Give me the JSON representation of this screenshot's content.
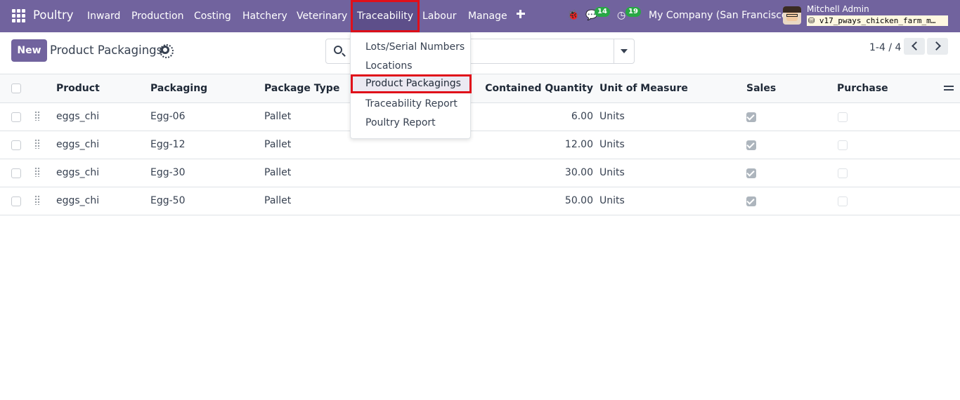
{
  "navbar": {
    "app_name": "Poultry",
    "menu": [
      {
        "label": "Inward",
        "active": false
      },
      {
        "label": "Production",
        "active": false
      },
      {
        "label": "Costing",
        "active": false
      },
      {
        "label": "Hatchery",
        "active": false
      },
      {
        "label": "Veterinary",
        "active": false
      },
      {
        "label": "Traceability",
        "active": true
      },
      {
        "label": "Labour",
        "active": false
      },
      {
        "label": "Manage",
        "active": false
      }
    ],
    "messages_count": "14",
    "activities_count": "19",
    "company": "My Company (San Francisco)",
    "user_name": "Mitchell Admin",
    "database": "v17_pways_chicken_farm_m…"
  },
  "control": {
    "new_label": "New",
    "title": "Product Packagings",
    "search_placeholder": "",
    "pager": "1-4 / 4"
  },
  "dropdown": {
    "items": [
      {
        "label": "Lots/Serial Numbers",
        "selected": false
      },
      {
        "label": "Locations",
        "selected": false
      },
      {
        "label": "Product Packagings",
        "selected": true
      },
      {
        "label": "Traceability Report",
        "selected": false
      },
      {
        "label": "Poultry Report",
        "selected": false
      }
    ]
  },
  "table": {
    "columns": [
      "Product",
      "Packaging",
      "Package Type",
      "Contained Quantity",
      "Unit of Measure",
      "Sales",
      "Purchase"
    ],
    "rows": [
      {
        "product": "eggs_chi",
        "packaging": "Egg-06",
        "package_type": "Pallet",
        "qty": "6.00",
        "uom": "Units",
        "sales": true,
        "purchase": false
      },
      {
        "product": "eggs_chi",
        "packaging": "Egg-12",
        "package_type": "Pallet",
        "qty": "12.00",
        "uom": "Units",
        "sales": true,
        "purchase": false
      },
      {
        "product": "eggs_chi",
        "packaging": "Egg-30",
        "package_type": "Pallet",
        "qty": "30.00",
        "uom": "Units",
        "sales": true,
        "purchase": false
      },
      {
        "product": "eggs_chi",
        "packaging": "Egg-50",
        "package_type": "Pallet",
        "qty": "50.00",
        "uom": "Units",
        "sales": true,
        "purchase": false
      }
    ]
  },
  "colors": {
    "navbar": "#71639e",
    "highlight_border": "#e0101a",
    "badge": "#28a745"
  }
}
